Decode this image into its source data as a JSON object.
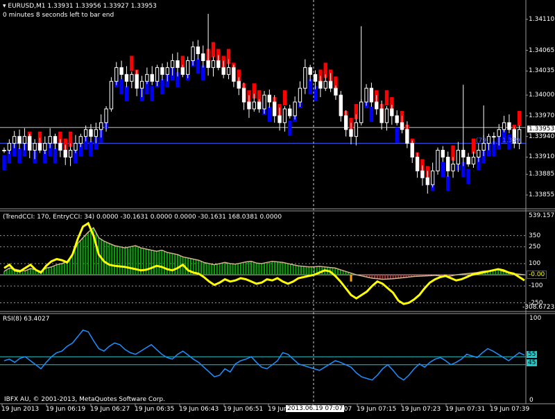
{
  "main": {
    "header": "EURUSD,M1  1.33931 1.33956 1.33927 1.33953",
    "timer": "0 minutes 8 seconds left to bar end",
    "current_price": "1.33953",
    "price_ticks": [
      "1.34110",
      "1.34065",
      "1.34035",
      "1.34000",
      "1.33970",
      "1.33940",
      "1.33910",
      "1.33885",
      "1.33855"
    ],
    "overlay_left": "(79.",
    "overlay_right": "1.339",
    "colors": {
      "bull_band": "#0000ff",
      "bear_band": "#ff0000",
      "candle": "#ffffff",
      "grid": "#9a9a9a"
    }
  },
  "cci": {
    "header": "(TrendCCI: 170, EntryCCI: 34)  0.0000  -30.1631 0.0000 0.0000 -30.1631 168.0381 0.0000",
    "ticks": [
      "539.1575",
      "350",
      "250",
      "100",
      "0.00",
      "-100",
      "-250"
    ],
    "top_value": "539.1575",
    "bottom_value": "-308.6723",
    "marker_value": "-0.00",
    "colors": {
      "entry_line": "#ffff00",
      "trend_line": "#d2b48c",
      "bar_up": "#00aa00",
      "bar_down": "#aa3333"
    }
  },
  "rsi": {
    "header": "RSI(8) 63.4027",
    "ticks": [
      "100",
      "0"
    ],
    "level_55": "55",
    "level_45": "45",
    "copyright": "IBFX AU, © 2001-2013, MetaQuotes Software Corp.",
    "color": "#1e90ff"
  },
  "time_axis": {
    "labels": [
      "19 Jun 2013",
      "19 Jun 06:19",
      "19 Jun 06:27",
      "19 Jun 06:35",
      "19 Jun 06:43",
      "19 Jun 06:51",
      "19 Jun 06:59",
      "19 Jun 07:07",
      "19 Jun 07:15",
      "19 Jun 07:23",
      "19 Jun 07:31",
      "19 Jun 07:39"
    ],
    "crosshair_label": "2013.06.19 07:07"
  },
  "chart_data": [
    {
      "type": "candlestick",
      "title": "EURUSD,M1",
      "ylim": [
        -308.6723,
        539.1575
      ],
      "close": [
        1.3392,
        1.3393,
        1.3394,
        1.3393,
        1.3394,
        1.3392,
        1.3393,
        1.3392,
        1.3393,
        1.3394,
        1.3393,
        1.3392,
        1.3391,
        1.3392,
        1.3393,
        1.3394,
        1.3395,
        1.3394,
        1.3395,
        1.3396,
        1.3398,
        1.3402,
        1.3404,
        1.3403,
        1.3402,
        1.3403,
        1.3401,
        1.3402,
        1.3403,
        1.3402,
        1.3404,
        1.3403,
        1.3404,
        1.3405,
        1.3404,
        1.3403,
        1.3405,
        1.3407,
        1.3406,
        1.3405,
        1.3404,
        1.3405,
        1.3404,
        1.3403,
        1.3404,
        1.3402,
        1.3401,
        1.3399,
        1.3398,
        1.3399,
        1.3398,
        1.34,
        1.3399,
        1.3397,
        1.3396,
        1.3398,
        1.3397,
        1.3399,
        1.3401,
        1.3404,
        1.3403,
        1.3402,
        1.3401,
        1.3402,
        1.3401,
        1.34,
        1.3397,
        1.3395,
        1.3394,
        1.3396,
        1.3399,
        1.3401,
        1.3399,
        1.3398,
        1.3396,
        1.3398,
        1.3397,
        1.3396,
        1.3395,
        1.3393,
        1.3391,
        1.3389,
        1.3388,
        1.3387,
        1.3389,
        1.3392,
        1.3391,
        1.3389,
        1.339,
        1.3392,
        1.3391,
        1.339,
        1.3391,
        1.3392,
        1.3393,
        1.3394,
        1.3394,
        1.3395,
        1.3396,
        1.3395,
        1.3393,
        1.3395
      ],
      "series": [
        {
          "name": "TrendCCI:170",
          "type": "line",
          "values": [
            30,
            60,
            50,
            40,
            35,
            55,
            45,
            30,
            60,
            70,
            90,
            100,
            120,
            180,
            280,
            330,
            380,
            420,
            330,
            300,
            280,
            260,
            250,
            240,
            250,
            260,
            240,
            230,
            220,
            210,
            220,
            200,
            190,
            180,
            160,
            150,
            140,
            130,
            110,
            100,
            90,
            100,
            110,
            100,
            95,
            105,
            115,
            120,
            105,
            100,
            110,
            120,
            115,
            110,
            100,
            90,
            80,
            75,
            70,
            72,
            75,
            70,
            65,
            60,
            45,
            30,
            15,
            0,
            -10,
            -20,
            -30,
            -35,
            -40,
            -38,
            -35,
            -30,
            -25,
            -20,
            -15,
            -12,
            -10,
            -8,
            -5,
            -10,
            -15,
            -10,
            0,
            5,
            10,
            15,
            20,
            30,
            35,
            40,
            45,
            30,
            20,
            10,
            5,
            0
          ]
        },
        {
          "name": "EntryCCI:34",
          "type": "line",
          "values": [
            60,
            90,
            40,
            30,
            60,
            90,
            45,
            20,
            80,
            120,
            140,
            130,
            110,
            180,
            320,
            430,
            460,
            350,
            180,
            120,
            90,
            80,
            75,
            70,
            60,
            50,
            40,
            45,
            60,
            80,
            70,
            50,
            40,
            60,
            90,
            40,
            20,
            10,
            -20,
            -60,
            -90,
            -70,
            -40,
            -60,
            -50,
            -30,
            -40,
            -60,
            -80,
            -70,
            -40,
            -50,
            -30,
            -60,
            -80,
            -60,
            -30,
            -20,
            -10,
            0,
            20,
            40,
            30,
            -10,
            -60,
            -120,
            -180,
            -210,
            -180,
            -150,
            -100,
            -60,
            -80,
            -120,
            -160,
            -230,
            -260,
            -250,
            -220,
            -180,
            -120,
            -70,
            -40,
            -20,
            -10,
            -30,
            -50,
            -40,
            -20,
            0,
            10,
            20,
            30,
            40,
            50,
            40,
            20,
            10,
            -20,
            -50
          ]
        }
      ],
      "levels": [
        350,
        250,
        100,
        0,
        -100,
        -250
      ]
    },
    {
      "type": "line",
      "title": "RSI(8) 63.4027",
      "ylim": [
        0,
        100
      ],
      "levels": [
        55,
        45
      ],
      "series": [
        {
          "name": "RSI(8)",
          "values": [
            50,
            52,
            48,
            53,
            55,
            50,
            45,
            40,
            48,
            55,
            60,
            62,
            68,
            72,
            80,
            88,
            86,
            75,
            65,
            62,
            68,
            72,
            70,
            64,
            60,
            58,
            62,
            66,
            70,
            64,
            58,
            54,
            52,
            58,
            62,
            57,
            52,
            48,
            42,
            36,
            30,
            32,
            40,
            36,
            46,
            50,
            52,
            55,
            48,
            42,
            40,
            45,
            50,
            60,
            58,
            52,
            46,
            44,
            42,
            40,
            38,
            42,
            46,
            50,
            48,
            45,
            42,
            35,
            30,
            28,
            26,
            32,
            40,
            45,
            38,
            30,
            26,
            32,
            40,
            46,
            42,
            48,
            52,
            54,
            50,
            45,
            48,
            52,
            58,
            56,
            54,
            60,
            65,
            62,
            58,
            54,
            50,
            55,
            60,
            57
          ]
        }
      ]
    }
  ]
}
